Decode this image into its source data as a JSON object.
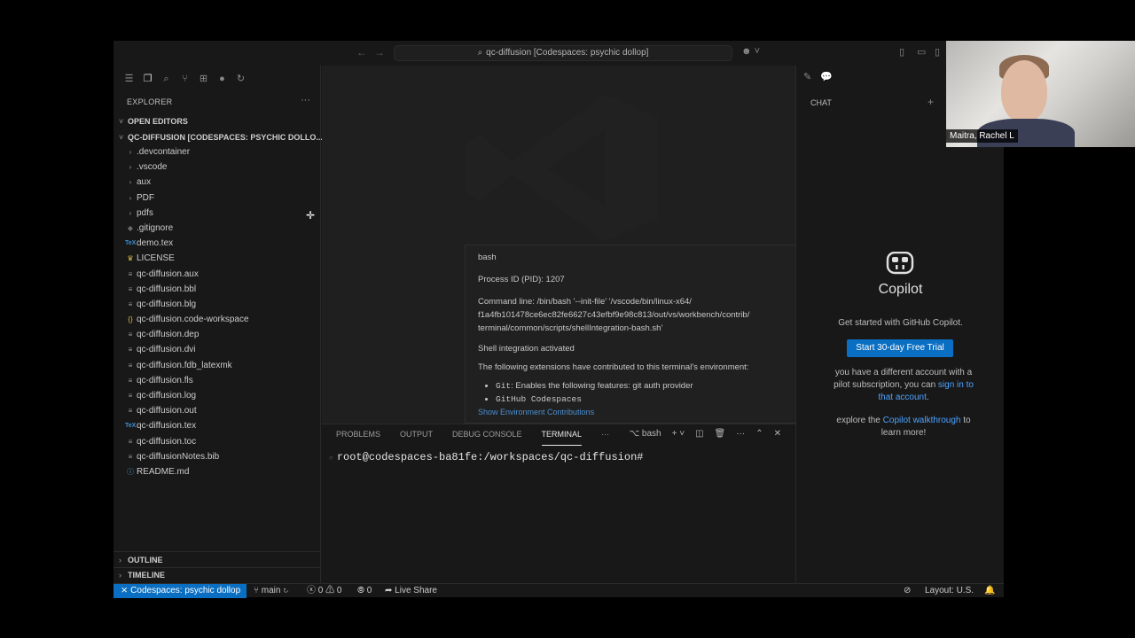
{
  "titlebar": {
    "search_text": "qc-diffusion [Codespaces: psychic dollop]"
  },
  "sidebar": {
    "explorer_title": "EXPLORER",
    "open_editors": "OPEN EDITORS",
    "workspace": "QC-DIFFUSION [CODESPACES: PSYCHIC DOLLO...",
    "files": [
      {
        "name": ".devcontainer",
        "icon": "chevron-right-icon"
      },
      {
        "name": ".vscode",
        "icon": "chevron-right-icon"
      },
      {
        "name": "aux",
        "icon": "chevron-right-icon"
      },
      {
        "name": "PDF",
        "icon": "chevron-right-icon"
      },
      {
        "name": "pdfs",
        "icon": "chevron-right-icon"
      },
      {
        "name": ".gitignore",
        "icon": "git-icon"
      },
      {
        "name": "demo.tex",
        "icon": "tex-icon"
      },
      {
        "name": "LICENSE",
        "icon": "license-icon"
      },
      {
        "name": "qc-diffusion.aux",
        "icon": "lines-icon"
      },
      {
        "name": "qc-diffusion.bbl",
        "icon": "lines-icon"
      },
      {
        "name": "qc-diffusion.blg",
        "icon": "lines-icon"
      },
      {
        "name": "qc-diffusion.code-workspace",
        "icon": "braces-icon"
      },
      {
        "name": "qc-diffusion.dep",
        "icon": "lines-icon"
      },
      {
        "name": "qc-diffusion.dvi",
        "icon": "lines-icon"
      },
      {
        "name": "qc-diffusion.fdb_latexmk",
        "icon": "lines-icon"
      },
      {
        "name": "qc-diffusion.fls",
        "icon": "lines-icon"
      },
      {
        "name": "qc-diffusion.log",
        "icon": "lines-icon"
      },
      {
        "name": "qc-diffusion.out",
        "icon": "lines-icon"
      },
      {
        "name": "qc-diffusion.tex",
        "icon": "tex-icon"
      },
      {
        "name": "qc-diffusion.toc",
        "icon": "lines-icon"
      },
      {
        "name": "qc-diffusionNotes.bib",
        "icon": "lines-icon"
      },
      {
        "name": "README.md",
        "icon": "info-icon"
      }
    ],
    "outline": "OUTLINE",
    "timeline": "TIMELINE"
  },
  "hover": {
    "title": "bash",
    "pid": "Process ID (PID): 1207",
    "cmd_1": "Command line: /bin/bash '--init-file' '/vscode/bin/linux-x64/",
    "cmd_2": "f1a4fb101478ce6ec82fe6627c43efbf9e98c813/out/vs/workbench/contrib/",
    "cmd_3": "terminal/common/scripts/shellIntegration-bash.sh'",
    "shell": "Shell integration activated",
    "ext_intro": "The following extensions have contributed to this terminal's environment:",
    "ext_1_name": "Git",
    "ext_1_desc": ": Enables the following features: git auth provider",
    "ext_2_name": "GitHub Codespaces",
    "contrib": "Show Environment Contributions"
  },
  "panel": {
    "tabs": [
      "PROBLEMS",
      "OUTPUT",
      "DEBUG CONSOLE",
      "TERMINAL"
    ],
    "more": "···",
    "shell": "bash",
    "prompt": "root@codespaces-ba81fe:/workspaces/qc-diffusion#"
  },
  "chat": {
    "title": "CHAT",
    "name": "Copilot",
    "subtitle": "Get started with GitHub Copilot.",
    "trial_button": "Start 30-day Free Trial",
    "account_1": "you have a different account with a",
    "account_2a": "pilot subscription, you can ",
    "account_2_link": "sign in to",
    "account_3_link": "that account",
    "account_3b": ".",
    "explore_1a": "explore the ",
    "explore_1_link": "Copilot walkthrough",
    "explore_1b": " to",
    "explore_2": "learn more!"
  },
  "statusbar": {
    "remote": "Codespaces: psychic dollop",
    "branch": "main",
    "errors": "0",
    "warnings": "0",
    "ports": "0",
    "liveshare": "Live Share",
    "layout": "Layout: U.S."
  },
  "webcam": {
    "name": "Maitra, Rachel L"
  },
  "colors": {
    "accent": "#0a6fc2",
    "background": "#181818",
    "editor": "#1f1f1f",
    "link": "#4da3ff"
  }
}
